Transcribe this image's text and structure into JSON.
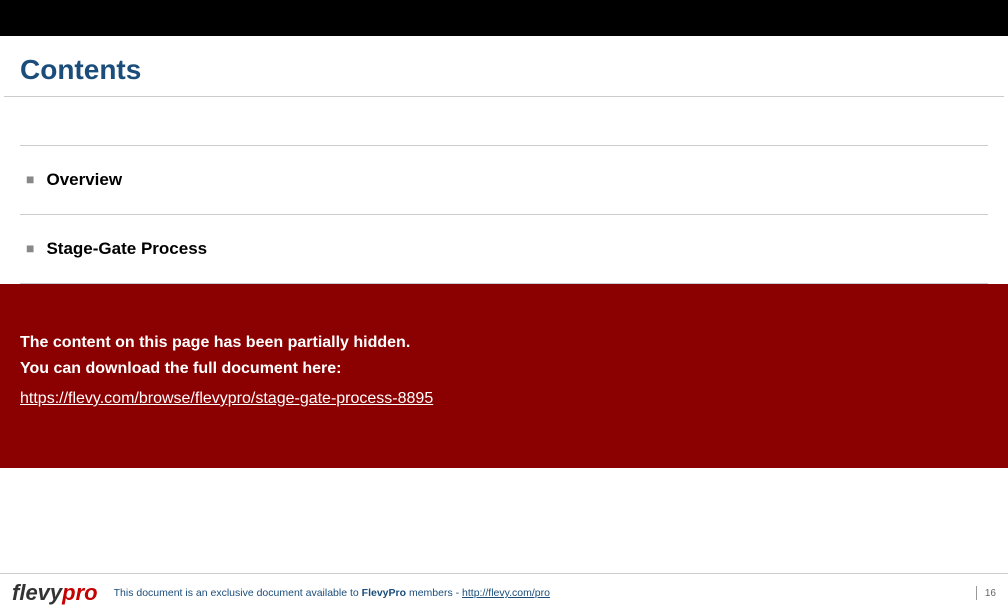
{
  "header": {
    "title": "Contents"
  },
  "contents": {
    "items": [
      {
        "label": "Overview"
      },
      {
        "label": "Stage-Gate Process"
      }
    ]
  },
  "hidden_banner": {
    "line1": "The content on this page has been partially hidden.",
    "line2": "You can download the full document here:",
    "link_text": "https://flevy.com/browse/flevypro/stage-gate-process-8895"
  },
  "footer": {
    "logo_part1": "flevy",
    "logo_part2": "pro",
    "text_prefix": "This document is an exclusive document available to ",
    "text_bold": "FlevyPro",
    "text_suffix": " members - ",
    "link_text": "http://flevy.com/pro",
    "page_number": "16"
  }
}
